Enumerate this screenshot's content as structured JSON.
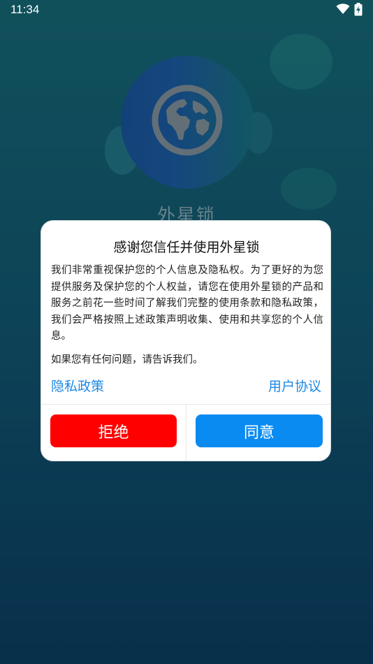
{
  "status_bar": {
    "time": "11:34"
  },
  "app": {
    "name": "外星锁"
  },
  "dialog": {
    "title": "感谢您信任并使用外星锁",
    "body": "我们非常重视保护您的个人信息及隐私权。为了更好的为您提供服务及保护您的个人权益，请您在使用外星锁的产品和服务之前花一些时间了解我们完整的使用条款和隐私政策，我们会严格按照上述政策声明收集、使用和共享您的个人信息。",
    "note": "如果您有任何问题，请告诉我们。",
    "privacy_link": "隐私政策",
    "agreement_link": "用户协议",
    "reject_label": "拒绝",
    "agree_label": "同意"
  },
  "icons": {
    "globe": "globe-icon",
    "wifi": "wifi-icon",
    "battery": "battery-charging-icon"
  },
  "colors": {
    "reject_button": "#ff0000",
    "agree_button": "#0a8bf2",
    "link": "#1e88e5"
  }
}
